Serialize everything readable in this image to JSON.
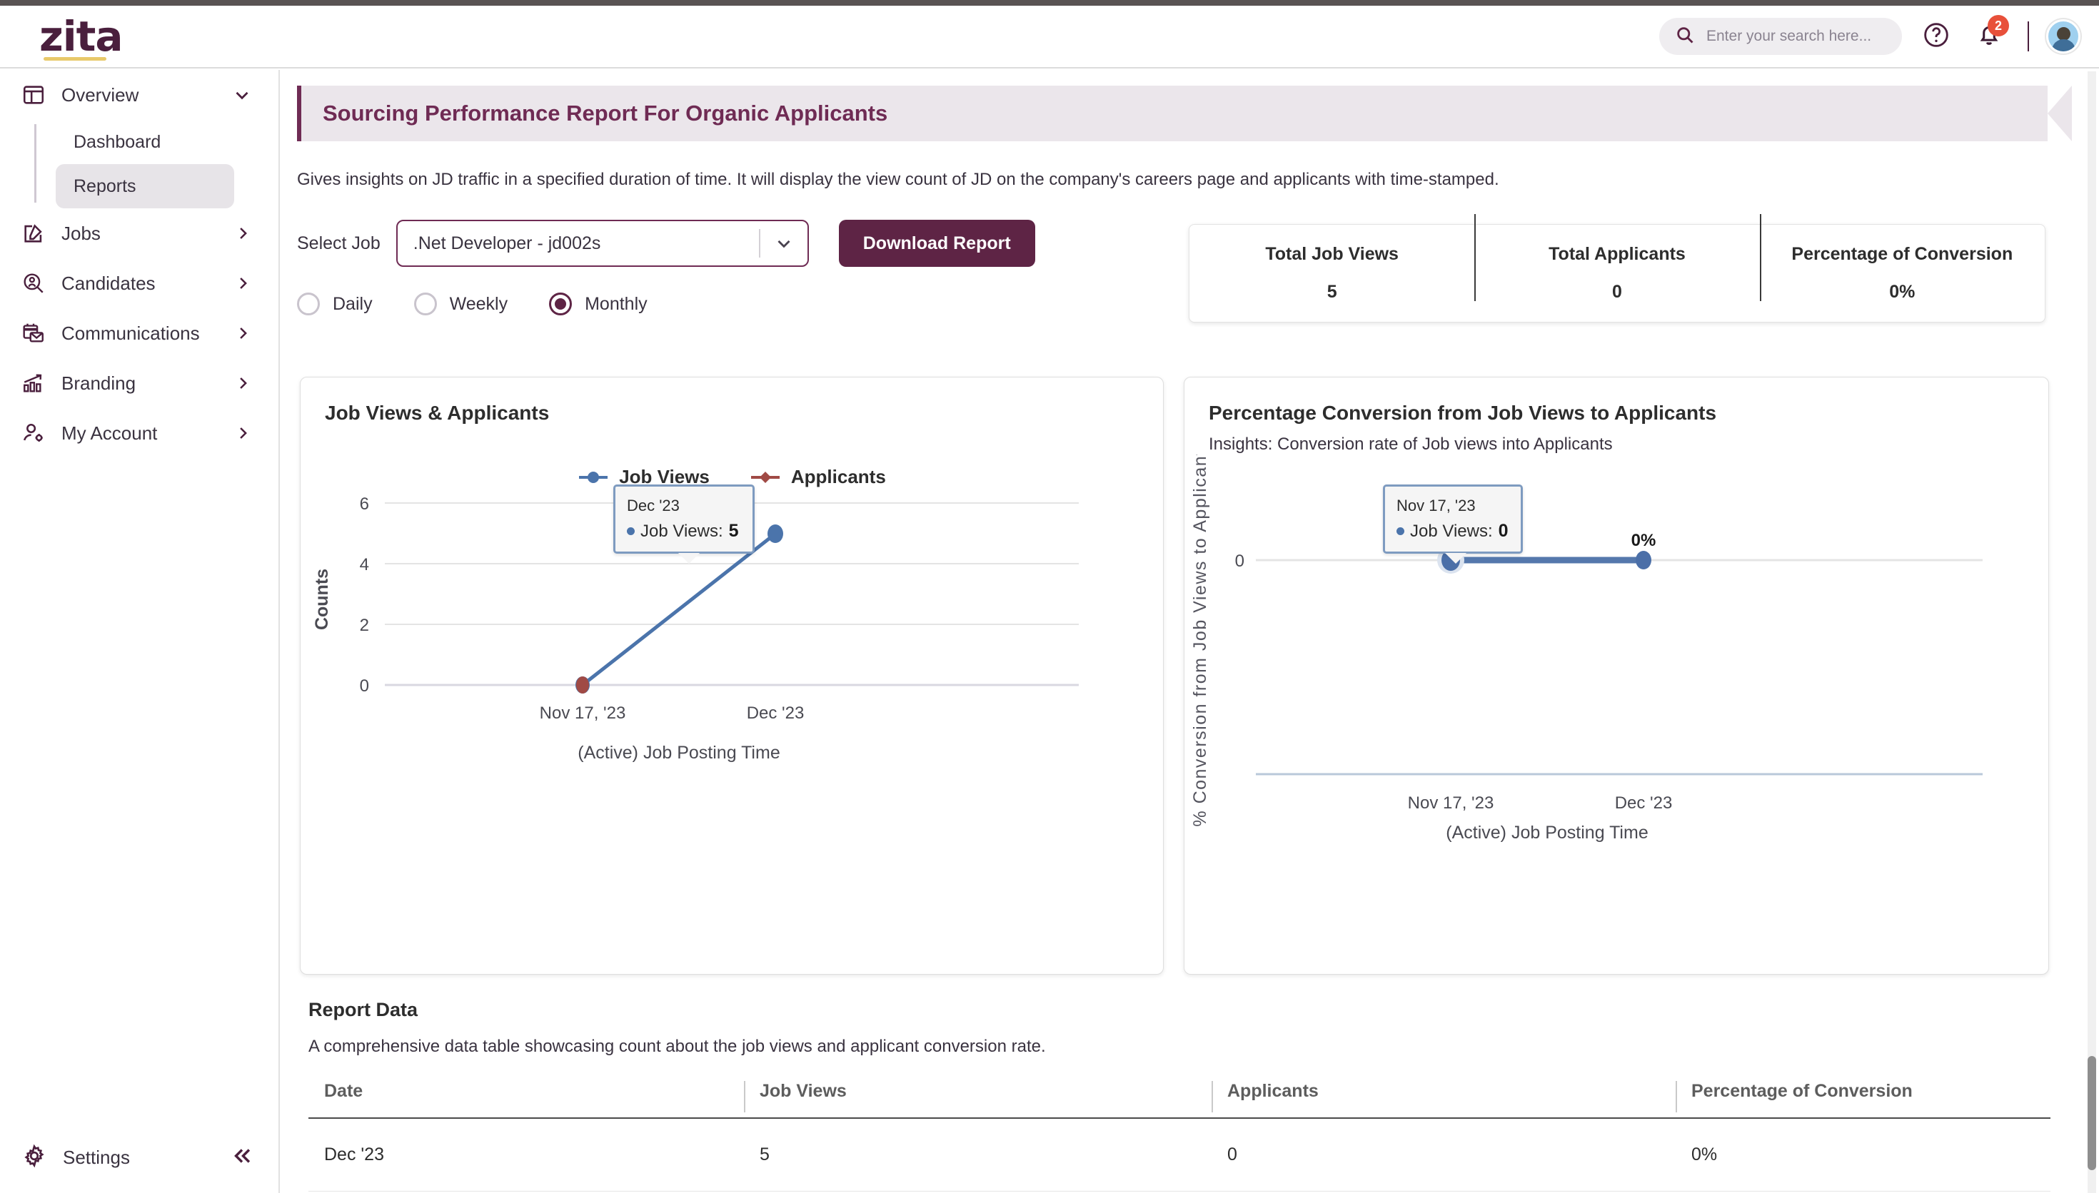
{
  "brand": {
    "logo_text": "zita",
    "accent": "#6f2b54",
    "logo_underline": "#e8c96a"
  },
  "header": {
    "search_placeholder": "Enter your search here...",
    "help_icon": "help-circle-icon",
    "notifications_icon": "bell-icon",
    "notification_count": "2",
    "avatar_icon": "user-avatar"
  },
  "sidebar": {
    "items": [
      {
        "label": "Overview",
        "icon": "layout-dashboard-icon",
        "chevron": "chevron-down-icon",
        "expanded": true
      },
      {
        "label": "Jobs",
        "icon": "edit-square-icon",
        "chevron": "chevron-right-icon"
      },
      {
        "label": "Candidates",
        "icon": "candidate-search-icon",
        "chevron": "chevron-right-icon"
      },
      {
        "label": "Communications",
        "icon": "calendar-mail-icon",
        "chevron": "chevron-right-icon"
      },
      {
        "label": "Branding",
        "icon": "bar-chart-trend-icon",
        "chevron": "chevron-right-icon"
      },
      {
        "label": "My Account",
        "icon": "user-gear-icon",
        "chevron": "chevron-right-icon"
      }
    ],
    "sub_items": [
      {
        "label": "Dashboard",
        "active": false
      },
      {
        "label": "Reports",
        "active": true
      }
    ],
    "footer": {
      "label": "Settings",
      "icon": "gear-icon",
      "collapse_icon": "chevrons-left-icon"
    }
  },
  "report": {
    "title": "Sourcing Performance Report For Organic Applicants",
    "description": "Gives insights on JD traffic in a specified duration of time. It will display the view count of JD on the company's careers page and applicants with time-stamped.",
    "select_job_label": "Select Job",
    "selected_job": ".Net Developer - jd002s",
    "download_label": "Download Report",
    "granularity": [
      {
        "label": "Daily",
        "checked": false
      },
      {
        "label": "Weekly",
        "checked": false
      },
      {
        "label": "Monthly",
        "checked": true
      }
    ]
  },
  "stats": [
    {
      "key": "Total Job Views",
      "value": "5"
    },
    {
      "key": "Total Applicants",
      "value": "0"
    },
    {
      "key": "Percentage of Conversion",
      "value": "0%"
    }
  ],
  "chart_data": [
    {
      "id": "job-views-applicants",
      "type": "line",
      "title": "Job Views & Applicants",
      "xlabel": "(Active) Job Posting Time",
      "ylabel": "Counts",
      "x": [
        "Nov 17, '23",
        "Dec '23"
      ],
      "ylim": [
        0,
        6
      ],
      "yticks": [
        0,
        2,
        4,
        6
      ],
      "grid": true,
      "legend_position": "top-center",
      "series": [
        {
          "name": "Job Views",
          "color": "#4b74ab",
          "marker": "circle",
          "values": [
            0,
            5
          ]
        },
        {
          "name": "Applicants",
          "color": "#a04a45",
          "marker": "diamond",
          "values": [
            0,
            0
          ]
        }
      ],
      "tooltip": {
        "title": "Dec '23",
        "rows": [
          {
            "label": "Job Views:",
            "value": "5",
            "color": "#4b74ab"
          }
        ]
      }
    },
    {
      "id": "percentage-conversion",
      "type": "line",
      "title": "Percentage Conversion from Job Views to Applicants",
      "subtitle": "Insights: Conversion rate of Job views into Applicants",
      "xlabel": "(Active) Job Posting Time",
      "ylabel": "% Conversion from Job Views to Applicants",
      "x": [
        "Nov 17, '23",
        "Dec '23"
      ],
      "ylim": [
        0,
        0
      ],
      "yticks": [
        0
      ],
      "grid": true,
      "series": [
        {
          "name": "Job Views",
          "color": "#5578ac",
          "marker": "circle",
          "values": [
            0,
            0
          ],
          "data_labels": [
            "0%",
            "0%"
          ]
        }
      ],
      "tooltip": {
        "title": "Nov 17, '23",
        "rows": [
          {
            "label": "Job Views:",
            "value": "0",
            "color": "#4b74ab"
          }
        ]
      }
    }
  ],
  "report_data": {
    "title": "Report Data",
    "subtitle": "A comprehensive data table showcasing count about the job views and applicant conversion rate.",
    "columns": [
      "Date",
      "Job Views",
      "Applicants",
      "Percentage of Conversion"
    ],
    "rows": [
      [
        "Dec '23",
        "5",
        "0",
        "0%"
      ]
    ]
  }
}
